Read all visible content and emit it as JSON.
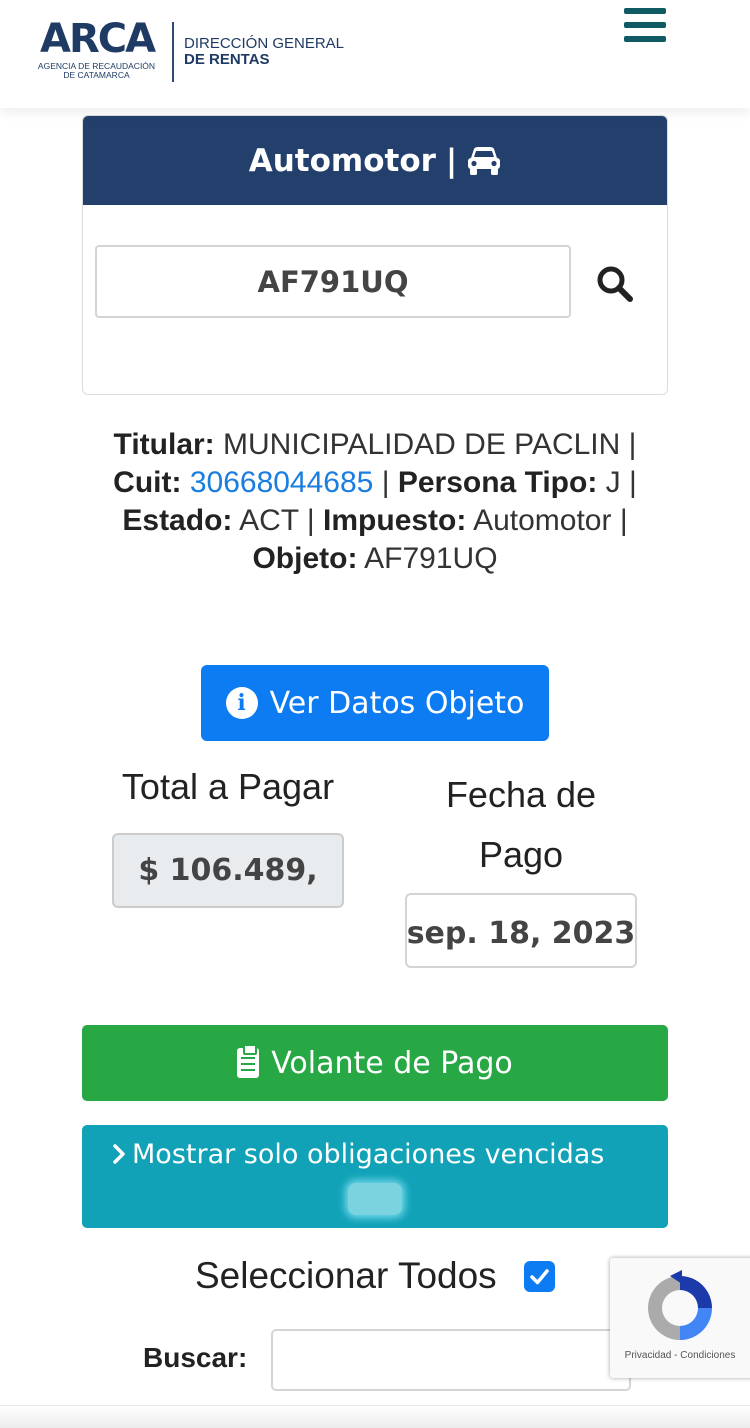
{
  "header": {
    "logo_text": "ARCA",
    "logo_subtitle": "AGENCIA DE RECAUDACIÓN DE CATAMARCA",
    "org_line1": "DIRECCIÓN GENERAL",
    "org_line2": "DE RENTAS"
  },
  "card": {
    "title": "Automotor",
    "separator": "|",
    "plate_value": "AF791UQ"
  },
  "info": {
    "titular_label": "Titular:",
    "titular_value": "MUNICIPALIDAD DE PACLIN",
    "cuit_label": "Cuit:",
    "cuit_value": "30668044685",
    "persona_label": "Persona Tipo:",
    "persona_value": "J",
    "estado_label": "Estado:",
    "estado_value": "ACT",
    "impuesto_label": "Impuesto:",
    "impuesto_value": "Automotor",
    "objeto_label": "Objeto:",
    "objeto_value": "AF791UQ",
    "sep": "|"
  },
  "buttons": {
    "ver_datos": "Ver Datos Objeto",
    "volante": "Volante de Pago",
    "mostrar": "Mostrar solo obligaciones vencidas"
  },
  "payment": {
    "total_label": "Total a Pagar",
    "total_value": "$ 106.489,",
    "fecha_label": "Fecha de Pago",
    "fecha_value": "sep. 18, 2023"
  },
  "selection": {
    "select_all_label": "Seleccionar Todos",
    "select_all_checked": true,
    "search_label": "Buscar:",
    "search_value": ""
  },
  "recaptcha": {
    "privacy": "Privacidad",
    "dash": "-",
    "terms": "Condiciones"
  },
  "colors": {
    "header_navy": "#233f6c",
    "primary_blue": "#0d7cf2",
    "success_green": "#28a745",
    "info_teal": "#11a2b8",
    "link_blue": "#1a7de0"
  },
  "icons": {
    "menu": "hamburger-icon",
    "car": "car-icon",
    "search": "search-icon",
    "info": "info-circle-icon",
    "clipboard": "clipboard-icon",
    "chevron": "chevron-right-icon",
    "check": "check-icon",
    "recaptcha": "recaptcha-icon"
  }
}
